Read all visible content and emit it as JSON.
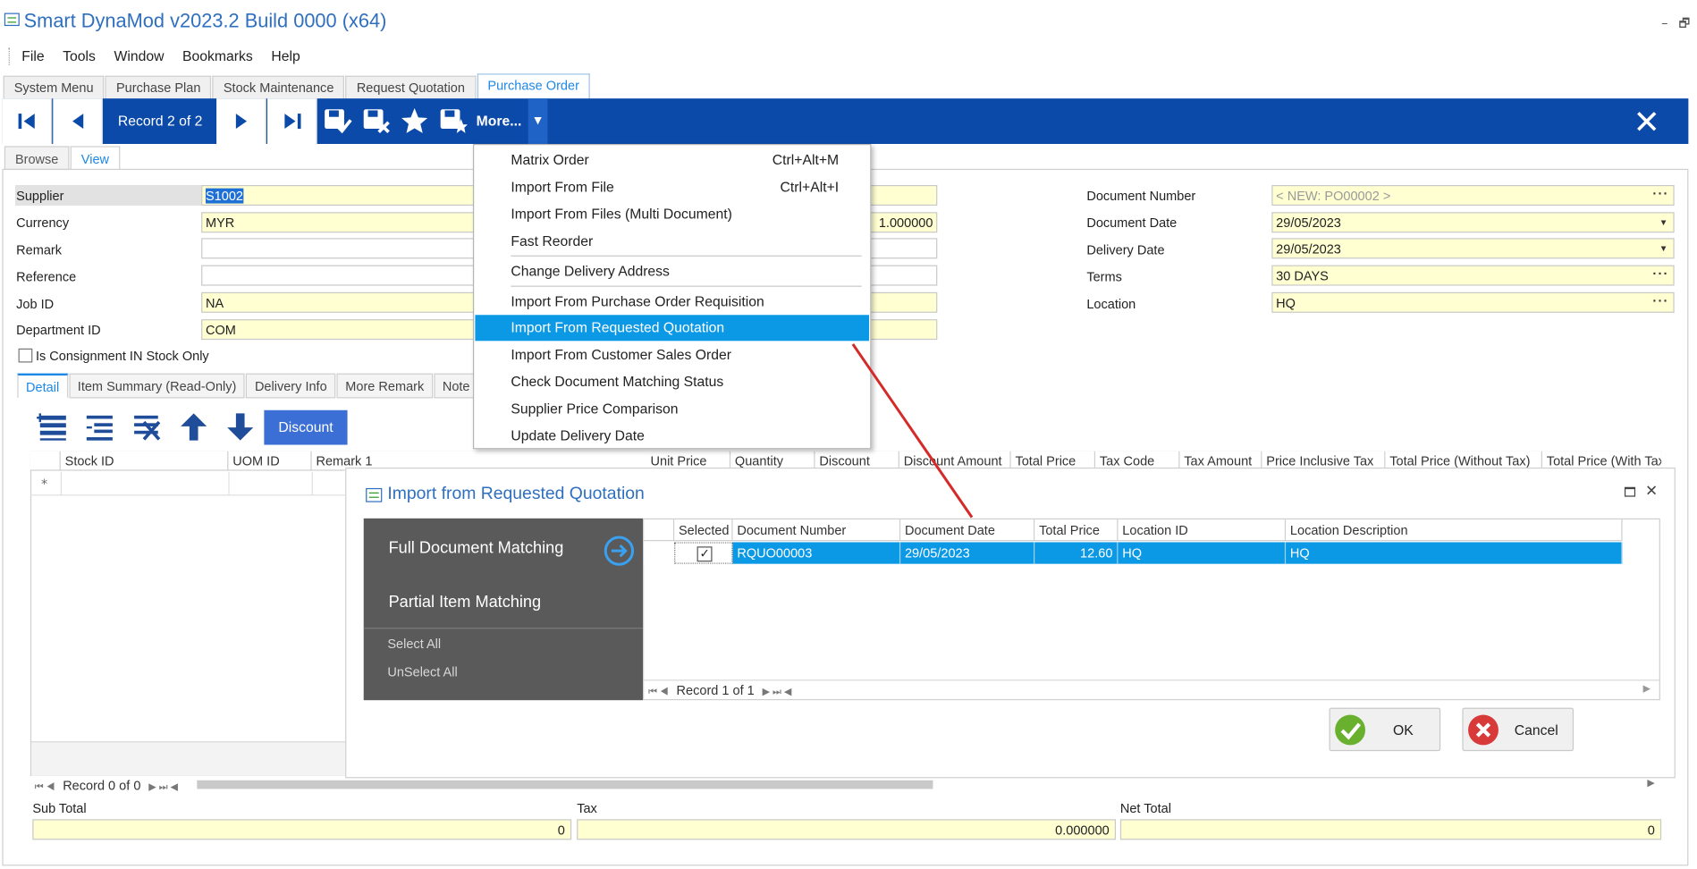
{
  "app": {
    "title": "Smart DynaMod v2023.2 Build 0000 (x64)",
    "min": "–",
    "restore": "🗗"
  },
  "menubar": [
    "File",
    "Tools",
    "Window",
    "Bookmarks",
    "Help"
  ],
  "tabs": [
    "System Menu",
    "Purchase Plan",
    "Stock Maintenance",
    "Request Quotation",
    "Purchase Order"
  ],
  "toolbar": {
    "record": "Record 2 of 2",
    "more": "More..."
  },
  "view_tabs": [
    "Browse",
    "View"
  ],
  "form": {
    "supplier_label": "Supplier",
    "supplier": "S1002",
    "currency_label": "Currency",
    "currency": "MYR",
    "rate": "1.000000",
    "remark_label": "Remark",
    "reference_label": "Reference",
    "jobid_label": "Job ID",
    "jobid": "NA",
    "dept_label": "Department ID",
    "dept": "COM",
    "consign_label": "Is Consignment IN Stock Only",
    "docno_label": "Document Number",
    "docno": "< NEW: PO00002 >",
    "docdate_label": "Document Date",
    "docdate": "29/05/2023",
    "deldate_label": "Delivery Date",
    "deldate": "29/05/2023",
    "terms_label": "Terms",
    "terms": "30 DAYS",
    "location_label": "Location",
    "location": "HQ"
  },
  "detail_tabs": [
    "Detail",
    "Item Summary (Read-Only)",
    "Delivery Info",
    "More Remark",
    "Note"
  ],
  "grid_toolbar": {
    "discount": "Discount"
  },
  "grid": {
    "headers_left": [
      "Stock ID",
      "UOM ID",
      "Remark 1"
    ],
    "headers_right": [
      "Unit Price",
      "Quantity",
      "Discount",
      "Discount Amount",
      "Total Price",
      "Tax Code",
      "Tax Amount",
      "Price Inclusive Tax",
      "Total Price (Without Tax)",
      "Total Price (With Tax)"
    ],
    "new_row_marker": "*",
    "record": "Record 0 of 0"
  },
  "totals": {
    "sub_label": "Sub Total",
    "sub": "0",
    "tax_label": "Tax",
    "tax": "0.000000",
    "net_label": "Net Total",
    "net": "0"
  },
  "more_menu": [
    {
      "label": "Matrix Order",
      "shortcut": "Ctrl+Alt+M"
    },
    {
      "label": "Import From File",
      "shortcut": "Ctrl+Alt+I"
    },
    {
      "label": "Import From Files (Multi Document)",
      "shortcut": ""
    },
    {
      "label": "Fast Reorder",
      "shortcut": ""
    },
    {
      "label": "Change Delivery Address",
      "shortcut": ""
    },
    {
      "label": "Import From Purchase Order Requisition",
      "shortcut": ""
    },
    {
      "label": "Import From Requested Quotation",
      "shortcut": ""
    },
    {
      "label": "Import From Customer Sales Order",
      "shortcut": ""
    },
    {
      "label": "Check Document Matching Status",
      "shortcut": ""
    },
    {
      "label": "Supplier Price Comparison",
      "shortcut": ""
    },
    {
      "label": "Update Delivery Date",
      "shortcut": ""
    }
  ],
  "dialog": {
    "title": "Import from Requested Quotation",
    "full_match": "Full Document Matching",
    "partial_match": "Partial Item Matching",
    "select_all": "Select All",
    "unselect_all": "UnSelect All",
    "headers": [
      "Selected",
      "Document Number",
      "Document Date",
      "Total Price",
      "Location ID",
      "Location Description"
    ],
    "row": {
      "selected": "✓",
      "docno": "RQUO00003",
      "date": "29/05/2023",
      "total": "12.60",
      "locid": "HQ",
      "locdesc": "HQ"
    },
    "record": "Record 1 of 1",
    "ok": "OK",
    "cancel": "Cancel"
  },
  "colors": {
    "toolbar": "#0b4aa8",
    "highlight": "#0b99e6",
    "field": "#ffffd2",
    "panel": "#5a5a5a"
  }
}
